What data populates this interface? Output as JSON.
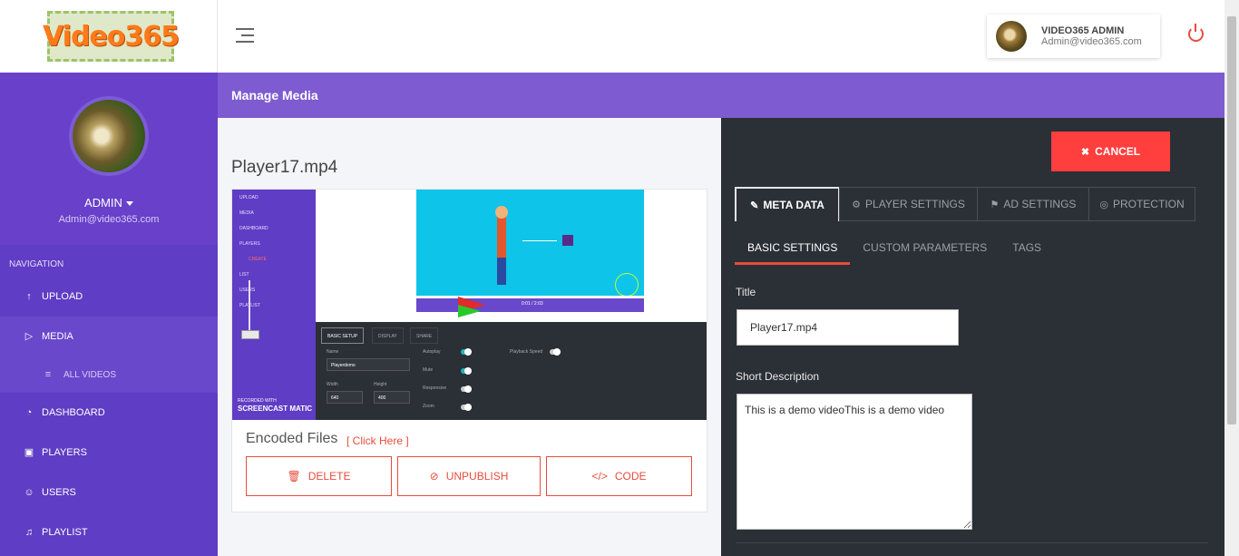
{
  "brand": {
    "logo_text": "Video365"
  },
  "header": {
    "user_name": "VIDEO365 ADMIN",
    "user_email": "Admin@video365.com"
  },
  "sidebar": {
    "profile_name": "ADMIN",
    "profile_email": "Admin@video365.com",
    "nav_heading": "NAVIGATION",
    "items": [
      {
        "label": "UPLOAD",
        "icon": "upload-icon"
      },
      {
        "label": "MEDIA",
        "icon": "play-icon"
      },
      {
        "label": "ALL VIDEOS",
        "icon": "list-icon"
      },
      {
        "label": "DASHBOARD",
        "icon": "dashboard-icon"
      },
      {
        "label": "PLAYERS",
        "icon": "player-icon"
      },
      {
        "label": "USERS",
        "icon": "user-icon"
      },
      {
        "label": "PLAYLIST",
        "icon": "playlist-icon"
      }
    ]
  },
  "page": {
    "title": "Manage Media"
  },
  "media": {
    "filename": "Player17.mp4",
    "encoded_label": "Encoded Files",
    "encoded_link": "[ Click Here ]",
    "delete_label": "DELETE",
    "unpublish_label": "UNPUBLISH",
    "code_label": "CODE"
  },
  "preview": {
    "side_items": [
      "UPLOAD",
      "MEDIA",
      "DASHBOARD",
      "PLAYERS",
      "CREATE",
      "LIST",
      "USERS",
      "PLAYLIST"
    ],
    "time": "0:01 / 2:03",
    "tab_basic": "BASIC SETUP",
    "tab_display": "DISPLAY",
    "tab_share": "SHARE",
    "name_label": "Name",
    "name_value": "Playerdemo",
    "width_label": "Width",
    "width_value": "640",
    "height_label": "Height",
    "height_value": "400",
    "autoplay_label": "Autoplay",
    "mute_label": "Mute",
    "responsive_label": "Responsive",
    "zoom_label": "Zoom",
    "playback_label": "Playback Speed",
    "watermark_top": "RECORDED WITH",
    "watermark_bottom": "SCREENCAST MATIC"
  },
  "editor": {
    "cancel_label": "CANCEL",
    "tabs": [
      {
        "label": "META DATA",
        "icon": "pencil-icon"
      },
      {
        "label": "PLAYER SETTINGS",
        "icon": "gear-icon"
      },
      {
        "label": "AD SETTINGS",
        "icon": "flag-icon"
      },
      {
        "label": "PROTECTION",
        "icon": "shield-icon"
      }
    ],
    "subtabs": [
      "BASIC SETTINGS",
      "CUSTOM PARAMETERS",
      "TAGS"
    ],
    "title_label": "Title",
    "title_value": "Player17.mp4",
    "desc_label": "Short Description",
    "desc_value": "This is a demo videoThis is a demo video"
  },
  "colors": {
    "sidebar": "#5f3dc4",
    "pagebar": "#7e5bd0",
    "accent": "#e74c3c",
    "panel": "#2b2f36"
  }
}
